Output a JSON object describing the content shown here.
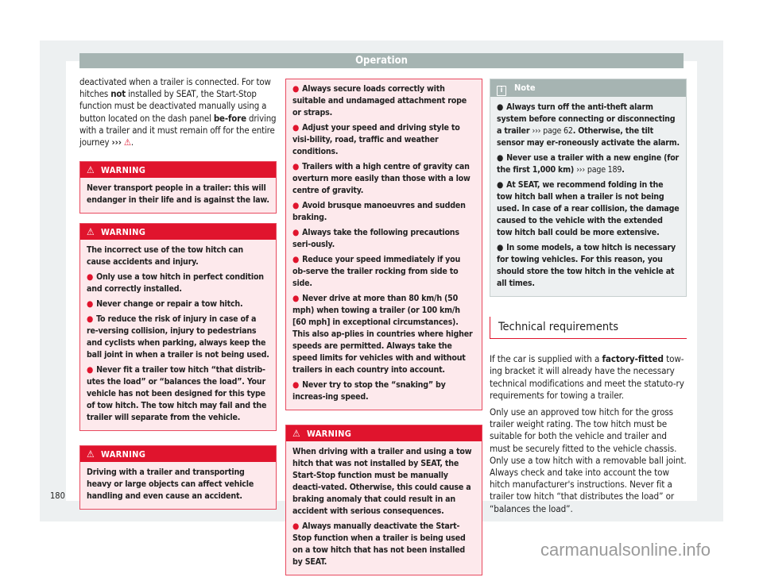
{
  "header": {
    "title": "Operation"
  },
  "page_number": "180",
  "column1": {
    "intro": {
      "t1": "deactivated when a trailer is connected. For tow hitches ",
      "b1": "not",
      "t2": " installed by SEAT, the Start-Stop function must be deactivated manually using a button located on the dash panel ",
      "b2": "be-fore",
      "t3": " driving with a trailer and it must remain off for the entire journey ",
      "arrow": "›››",
      "end": "."
    },
    "warning1": {
      "label": "WARNING",
      "text": "Never transport people in a trailer: this will endanger in their life and is against the law."
    },
    "warning2": {
      "label": "WARNING",
      "text": "The incorrect use of the tow hitch can cause accidents and injury.",
      "items": [
        "Only use a tow hitch in perfect condition and correctly installed.",
        "Never change or repair a tow hitch.",
        "To reduce the risk of injury in case of a re-versing collision, injury to pedestrians and cyclists when parking, always keep the ball joint in when a trailer is not being used.",
        "Never fit a trailer tow hitch “that distrib-utes the load” or “balances the load”. Your vehicle has not been designed for this type of tow hitch. The tow hitch may fail and the trailer will separate from the vehicle."
      ]
    },
    "warning3": {
      "label": "WARNING",
      "text": "Driving with a trailer and transporting heavy or large objects can affect vehicle handling and even cause an accident."
    }
  },
  "column2": {
    "continued_items": [
      "Always secure loads correctly with suitable and undamaged attachment rope or straps.",
      "Adjust your speed and driving style to visi-bility, road, traffic and weather conditions.",
      "Trailers with a high centre of gravity can overturn more easily than those with a low centre of gravity.",
      "Avoid brusque manoeuvres and sudden braking.",
      "Always take the following precautions seri-ously.",
      "Reduce your speed immediately if you ob-serve the trailer rocking from side to side.",
      "Never drive at more than 80 km/h (50 mph) when towing a trailer (or 100 km/h [60 mph] in exceptional circumstances). This also ap-plies in countries where higher speeds are permitted. Always take the speed limits for vehicles with and without trailers in each country into account.",
      "Never try to stop the “snaking” by increas-ing speed."
    ],
    "warning4": {
      "label": "WARNING",
      "text": "When driving with a trailer and using a tow hitch that was not installed by SEAT, the Start-Stop function must be manually deacti-vated. Otherwise, this could cause a braking anomaly that could result in an accident with serious consequences.",
      "items": [
        "Always manually deactivate the Start-Stop function when a trailer is being used on a tow hitch that has not been installed by SEAT."
      ]
    }
  },
  "column3": {
    "note": {
      "label": "Note",
      "items": [
        {
          "text": "Always turn off the anti-theft alarm system before connecting or disconnecting a trailer ",
          "link": "››› page 62",
          "after": ". Otherwise, the tilt sensor may er-roneously activate the alarm."
        },
        {
          "text": "Never use a trailer with a new engine (for the first 1,000 km) ",
          "link": "››› page 189",
          "after": "."
        },
        {
          "text": "At SEAT, we recommend folding in the tow hitch ball when a trailer is not being used. In case of a rear collision, the damage caused to the vehicle with the extended tow hitch ball could be more extensive.",
          "link": "",
          "after": ""
        },
        {
          "text": "In some models, a tow hitch is necessary for towing vehicles. For this reason, you should store the tow hitch in the vehicle at all times.",
          "link": "",
          "after": ""
        }
      ]
    },
    "section_title": "Technical requirements",
    "para1": {
      "t1": "If the car is supplied with a ",
      "b1": "factory-fitted",
      "t2": " tow-ing bracket it will already have the necessary technical modifications and meet the statuto-ry requirements for towing a trailer."
    },
    "para2": "Only use an approved tow hitch for the gross trailer weight rating. The tow hitch must be suitable for both the vehicle and trailer and must be securely fitted to the vehicle chassis. Only use a tow hitch with a removable ball joint. Always check and take into account the tow hitch manufacturer's instructions. Never fit a trailer tow hitch “that distributes the load” or “balances the load”."
  },
  "icons": {
    "warning": "⚠",
    "info": "i",
    "bullet": "●"
  },
  "colors": {
    "warning_red": "#e0142d",
    "warning_bg": "#fde9ec",
    "header_grey": "#a6b4b2",
    "frame_grey": "#edf0f1"
  },
  "watermark": "carmanualsonline.info"
}
